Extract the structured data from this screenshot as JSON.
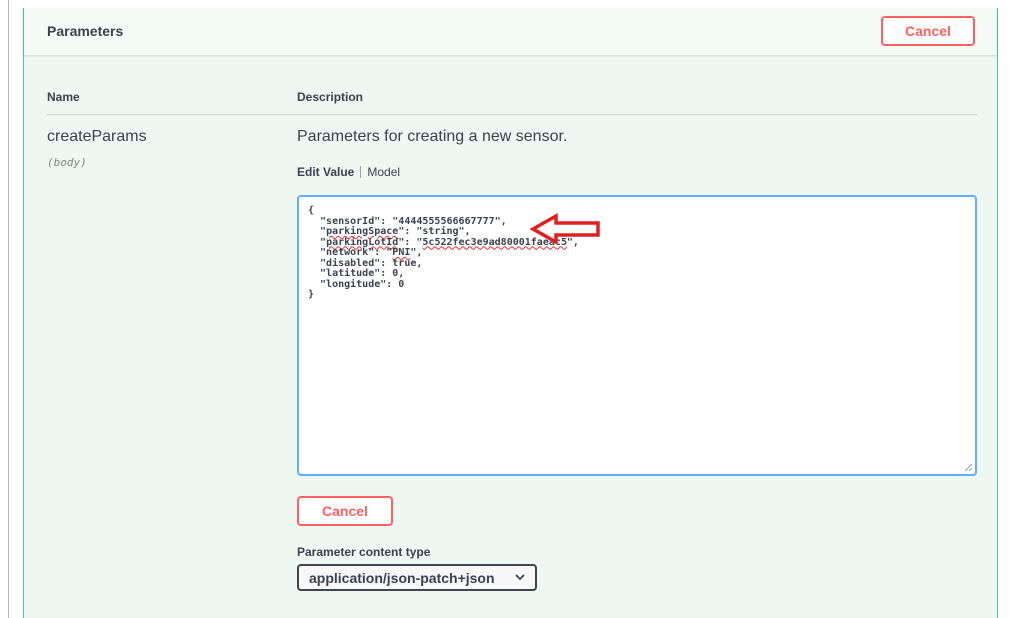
{
  "header": {
    "title": "Parameters",
    "cancel_label": "Cancel"
  },
  "table": {
    "name_header": "Name",
    "description_header": "Description"
  },
  "param": {
    "name": "createParams",
    "in": "(body)",
    "description": "Parameters for creating a new sensor."
  },
  "tabs": {
    "edit_value": "Edit Value",
    "model": "Model"
  },
  "editor": {
    "lines": [
      "{",
      "  \"sensorId\": \"4444555566667777\",",
      "  \"parkingSpace\": \"string\",",
      "  \"parkingLotId\": \"5c522fec3e9ad80001faeac5\",",
      "  \"network\": \"PNI\",",
      "  \"disabled\": true,",
      "  \"latitude\": 0,",
      "  \"longitude\": 0",
      "}"
    ]
  },
  "actions": {
    "cancel_label": "Cancel"
  },
  "content_type": {
    "label": "Parameter content type",
    "selected": "application/json-patch+json"
  },
  "colors": {
    "accent_green": "#49cc90",
    "cancel_red": "#ff6060",
    "editor_border": "#61affe",
    "annotation_red": "#e02020"
  },
  "icons": {
    "annotation": "red-arrow-icon",
    "dropdown": "chevron-down-icon",
    "resize": "resize-grip-icon"
  }
}
